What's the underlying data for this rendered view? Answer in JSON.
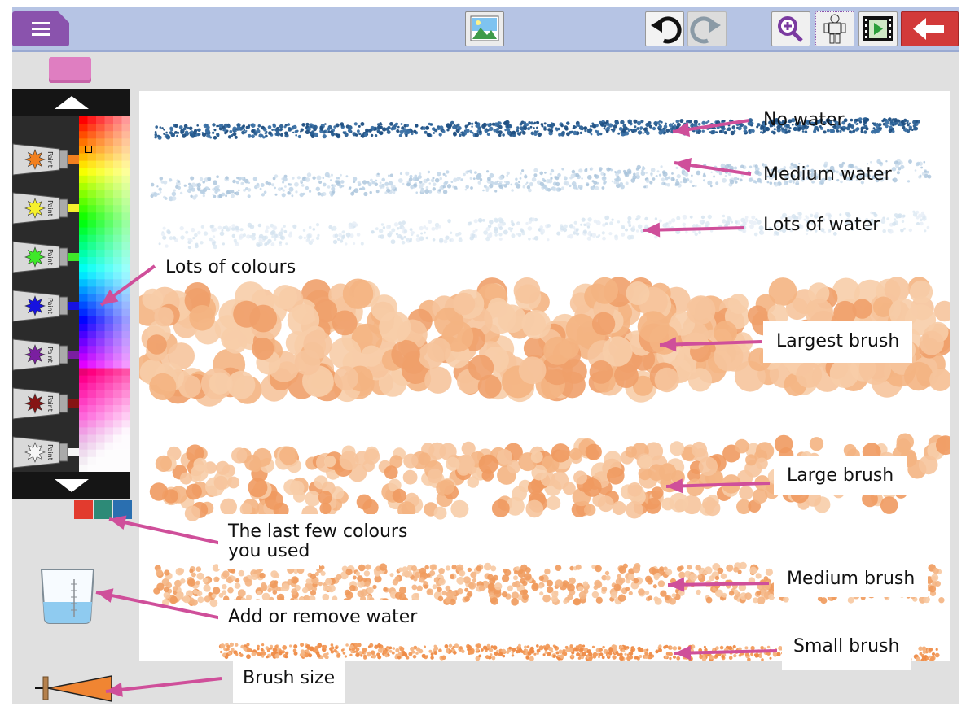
{
  "toolbar": {
    "menu_icon": "hamburger-menu-icon",
    "image_icon": "landscape-image-icon",
    "undo_icon": "undo-arrow-icon",
    "redo_icon": "redo-arrow-icon",
    "zoom_icon": "zoom-in-icon",
    "stamp_icon": "character-stamp-icon",
    "film_icon": "film-play-icon",
    "back_icon": "back-arrow-icon"
  },
  "palette": {
    "tubes": [
      {
        "color": "#f2801f",
        "label": "Paint"
      },
      {
        "color": "#f6f02c",
        "label": "Paint"
      },
      {
        "color": "#3ee82a",
        "label": "Paint"
      },
      {
        "color": "#1612e0",
        "label": "Paint"
      },
      {
        "color": "#7a1fa0",
        "label": "Paint"
      },
      {
        "color": "#861414",
        "label": "Paint"
      },
      {
        "color": "#f6f6f6",
        "label": "Paint"
      }
    ],
    "recent_colors": [
      "#e23b2e",
      "#2d8a77",
      "#2a6fb0"
    ]
  },
  "annotations": {
    "no_water": "No water",
    "medium_water": "Medium water",
    "lots_of_water": "Lots of water",
    "lots_of_colours": "Lots of colours",
    "largest_brush": "Largest brush",
    "large_brush": "Large brush",
    "last_colours_line1": "The last few colours",
    "last_colours_line2": "you used",
    "medium_brush": "Medium brush",
    "add_remove_water": "Add or remove water",
    "small_brush": "Small brush",
    "brush_size": "Brush size"
  },
  "colors": {
    "accent_purple": "#8a53ad",
    "toolbar_blue": "#b6c4e4",
    "back_red": "#d23a3a",
    "arrow_pink": "#cf4f9a",
    "stroke_blue": "#2a5f92",
    "stroke_orange": "#f4b482"
  }
}
